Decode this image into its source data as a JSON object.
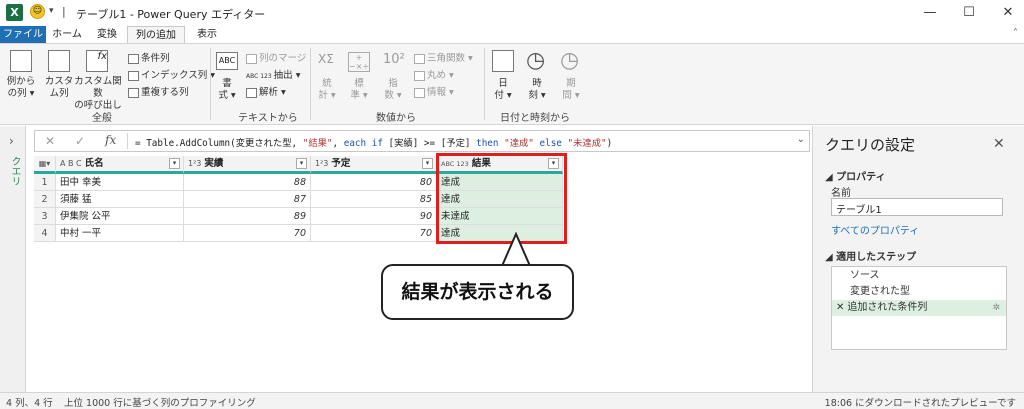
{
  "window": {
    "title": "テーブル1 - Power Query エディター",
    "excel_glyph": "X",
    "smiley_glyph": "☺",
    "qat_dropdown": "▾",
    "qat_separator": "|",
    "minimize": "—",
    "maximize": "☐",
    "close": "✕",
    "collapse_ribbon": "˄"
  },
  "tabs": [
    "ファイル",
    "ホーム",
    "変換",
    "列の追加",
    "表示"
  ],
  "ribbon": {
    "general": {
      "col_from_examples": [
        "例から",
        "の列 ▾"
      ],
      "custom_column": [
        "カスタ",
        "ム列"
      ],
      "invoke_custom_function": [
        "カスタム関数",
        "の呼び出し"
      ],
      "conditional_column": "条件列",
      "index_column": "インデックス列 ▾",
      "duplicate_column": "重複する列",
      "group_label": "全般"
    },
    "text": {
      "format": [
        "書",
        "式 ▾"
      ],
      "merge_columns": "列のマージ",
      "extract": "抽出 ▾",
      "parse": "解析 ▾",
      "group_label": "テキストから",
      "abc_glyph": "ABC",
      "abc123_glyph": "ABC 123"
    },
    "number": {
      "statistics": [
        "統",
        "計 ▾"
      ],
      "standard": [
        "標",
        "準 ▾"
      ],
      "scientific": [
        "指",
        "数 ▾"
      ],
      "trigonometry": "三角関数 ▾",
      "rounding": "丸め ▾",
      "information": "情報 ▾",
      "group_label": "数値から",
      "sigma_glyph": "XΣ",
      "power_glyph": "10²",
      "plusminus_glyph": "+−×÷"
    },
    "datetime": {
      "date": [
        "日",
        "付 ▾"
      ],
      "time": [
        "時",
        "刻 ▾"
      ],
      "duration": [
        "期",
        "間 ▾"
      ],
      "group_label": "日付と時刻から",
      "clock_glyph": "◷"
    }
  },
  "left_pane": {
    "label": "クエリ",
    "chevron": "›"
  },
  "formula_bar": {
    "cancel": "✕",
    "confirm": "✓",
    "fx": "fx",
    "expand": "⌄",
    "tokens": [
      {
        "t": "= Table.AddColumn(変更された型, ",
        "c": ""
      },
      {
        "t": "\"結果\"",
        "c": "str"
      },
      {
        "t": ", ",
        "c": ""
      },
      {
        "t": "each if",
        "c": "kw"
      },
      {
        "t": " [実績] >= [予定] ",
        "c": ""
      },
      {
        "t": "then",
        "c": "kw"
      },
      {
        "t": " ",
        "c": ""
      },
      {
        "t": "\"達成\"",
        "c": "str"
      },
      {
        "t": " ",
        "c": ""
      },
      {
        "t": "else",
        "c": "kw"
      },
      {
        "t": " ",
        "c": ""
      },
      {
        "t": "\"未達成\"",
        "c": "str"
      },
      {
        "t": ")",
        "c": ""
      }
    ]
  },
  "table": {
    "columns": [
      {
        "type": "A B C",
        "name": "氏名"
      },
      {
        "type": "1²3",
        "name": "実績"
      },
      {
        "type": "1²3",
        "name": "予定"
      },
      {
        "type": "ABC 123",
        "name": "結果"
      }
    ],
    "corner": "▦▾",
    "dropdown_glyph": "▾",
    "rows": [
      {
        "n": "1",
        "name": "田中 幸美",
        "actual": "88",
        "plan": "80",
        "result": "達成"
      },
      {
        "n": "2",
        "name": "須藤 猛",
        "actual": "87",
        "plan": "85",
        "result": "達成"
      },
      {
        "n": "3",
        "name": "伊集院 公平",
        "actual": "89",
        "plan": "90",
        "result": "未達成"
      },
      {
        "n": "4",
        "name": "中村 一平",
        "actual": "70",
        "plan": "70",
        "result": "達成"
      }
    ]
  },
  "callout": "結果が表示される",
  "query_settings": {
    "title": "クエリの設定",
    "close": "✕",
    "properties_header": "◢ プロパティ",
    "name_label": "名前",
    "name_value": "テーブル1",
    "all_properties_link": "すべてのプロパティ",
    "applied_steps_header": "◢ 適用したステップ",
    "steps": [
      "ソース",
      "変更された型",
      "追加された条件列"
    ],
    "step_delete_glyph": "✕",
    "step_gear_glyph": "✲"
  },
  "status": {
    "cols_rows": "4 列、4 行",
    "profiling": "上位 1000 行に基づく列のプロファイリング",
    "download": "18:06 にダウンロードされたプレビューです"
  }
}
